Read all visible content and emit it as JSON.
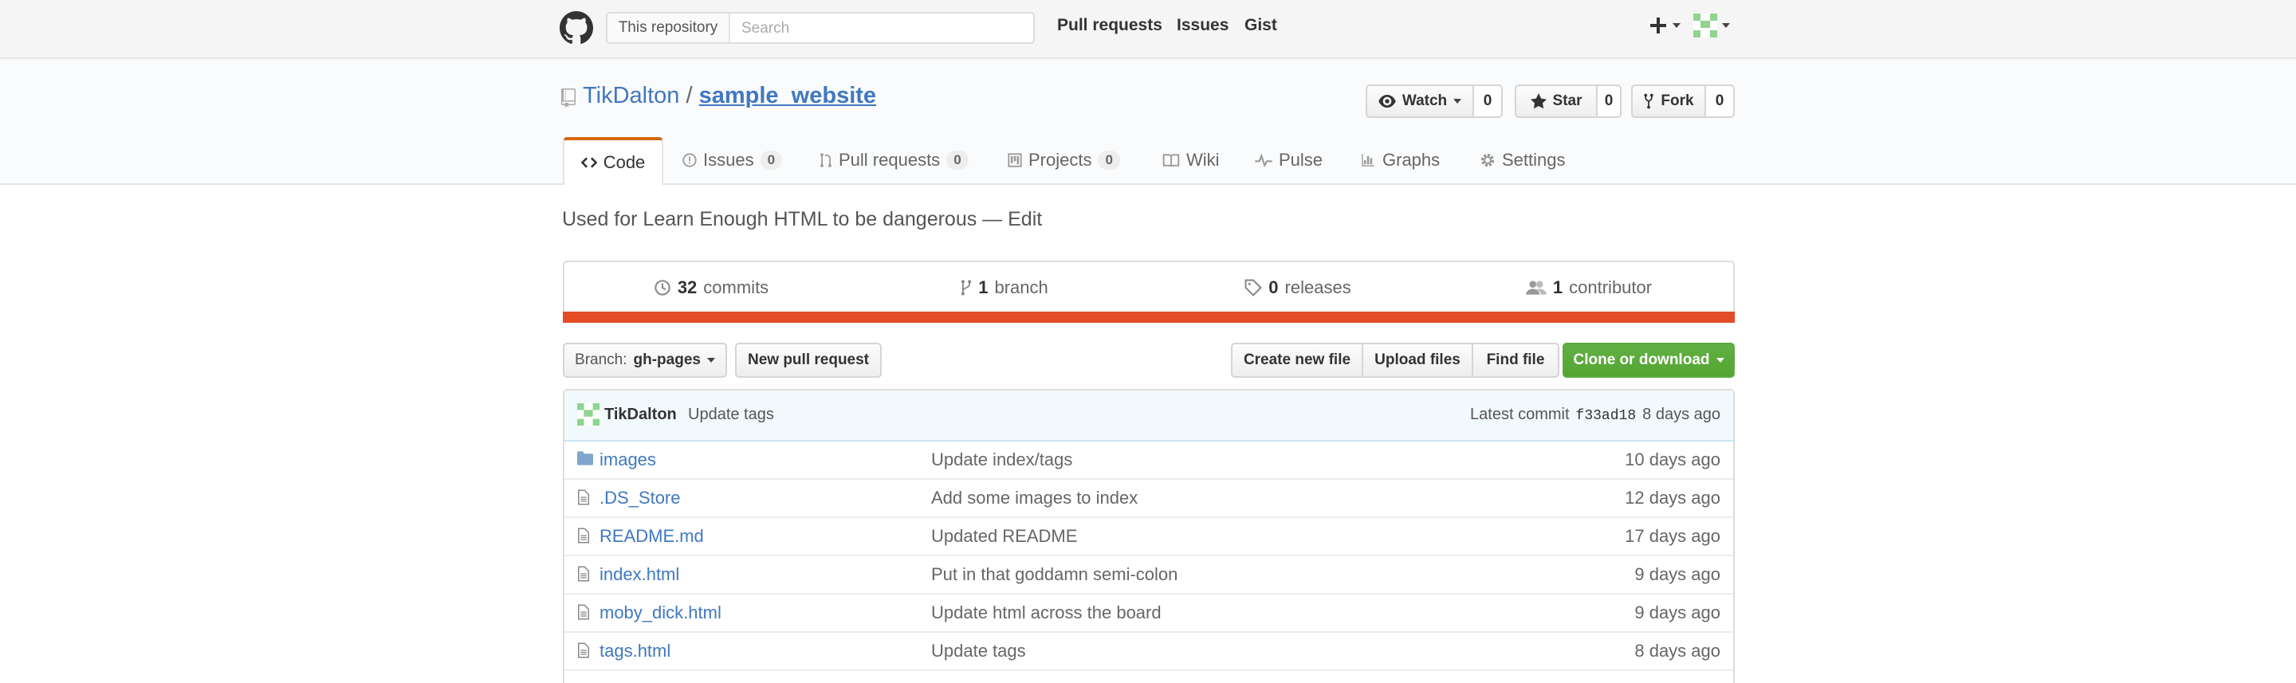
{
  "header": {
    "scope_label": "This repository",
    "search_placeholder": "Search",
    "nav": [
      "Pull requests",
      "Issues",
      "Gist"
    ]
  },
  "repo": {
    "owner": "TikDalton",
    "separator": "/",
    "name": "sample_website",
    "watch": {
      "label": "Watch",
      "count": "0"
    },
    "star": {
      "label": "Star",
      "count": "0"
    },
    "fork": {
      "label": "Fork",
      "count": "0"
    },
    "tabs": [
      {
        "label": "Code",
        "icon": "code-icon",
        "selected": true
      },
      {
        "label": "Issues",
        "icon": "issue-icon",
        "counter": "0"
      },
      {
        "label": "Pull requests",
        "icon": "pull-request-icon",
        "counter": "0"
      },
      {
        "label": "Projects",
        "icon": "project-icon",
        "counter": "0"
      },
      {
        "label": "Wiki",
        "icon": "book-icon"
      },
      {
        "label": "Pulse",
        "icon": "pulse-icon"
      },
      {
        "label": "Graphs",
        "icon": "graph-icon"
      },
      {
        "label": "Settings",
        "icon": "gear-icon"
      }
    ]
  },
  "description": "Used for Learn Enough HTML to be dangerous — Edit",
  "summary": {
    "commits": {
      "count": "32",
      "label": "commits"
    },
    "branches": {
      "count": "1",
      "label": "branch"
    },
    "releases": {
      "count": "0",
      "label": "releases"
    },
    "contributors": {
      "count": "1",
      "label": "contributor"
    }
  },
  "language_color": "#e34c26",
  "file_nav": {
    "branch_prefix": "Branch:",
    "branch_name": "gh-pages",
    "new_pull_request": "New pull request",
    "create_new_file": "Create new file",
    "upload_files": "Upload files",
    "find_file": "Find file",
    "clone_or_download": "Clone or download"
  },
  "latest_commit": {
    "author": "TikDalton",
    "message": "Update tags",
    "label": "Latest commit",
    "sha": "f33ad18",
    "age": "8 days ago"
  },
  "files": [
    {
      "name": "images",
      "type": "directory",
      "message": "Update index/tags",
      "age": "10 days ago"
    },
    {
      "name": ".DS_Store",
      "type": "file",
      "message": "Add some images to index",
      "age": "12 days ago"
    },
    {
      "name": "README.md",
      "type": "file",
      "message": "Updated README",
      "age": "17 days ago"
    },
    {
      "name": "index.html",
      "type": "file",
      "message": "Put in that goddamn semi-colon",
      "age": "9 days ago"
    },
    {
      "name": "moby_dick.html",
      "type": "file",
      "message": "Update html across the board",
      "age": "9 days ago"
    },
    {
      "name": "tags.html",
      "type": "file",
      "message": "Update tags",
      "age": "8 days ago"
    }
  ],
  "colors": {
    "link": "#4078c0",
    "green": "#55a532",
    "tab_accent": "#d26911"
  }
}
